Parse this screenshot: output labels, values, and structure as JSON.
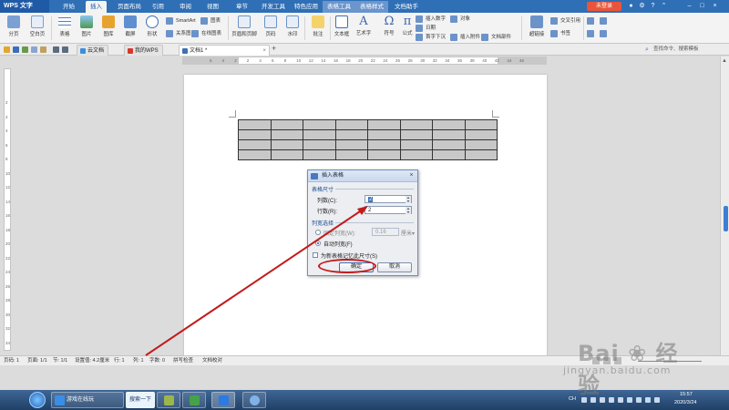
{
  "app": {
    "brand": "WPS 文字"
  },
  "menu": {
    "tabs": [
      {
        "label": "开始"
      },
      {
        "label": "插入"
      },
      {
        "label": "页面布局"
      },
      {
        "label": "引用"
      },
      {
        "label": "审阅"
      },
      {
        "label": "视图"
      },
      {
        "label": "章节"
      },
      {
        "label": "开发工具"
      },
      {
        "label": "特色应用"
      },
      {
        "label": "表格工具"
      },
      {
        "label": "表格样式"
      },
      {
        "label": "文档助手"
      }
    ],
    "login": "未登录"
  },
  "ribbon": {
    "fenye": "分页",
    "blank_page": "空白页",
    "table": "表格",
    "picture": "图片",
    "gallery": "图库",
    "screenshot": "截屏",
    "shape": "形状",
    "smartart": "SmartArt",
    "chart": "图表",
    "relation_map": "关系图",
    "online_chart": "在线图表",
    "header_footer": "页眉和页脚",
    "page_number": "页码",
    "watermark": "水印",
    "comment": "批注",
    "textbox": "文本框",
    "wordart": "艺术字",
    "symbol": "符号",
    "formula": "公式",
    "insert_number": "插入数字",
    "object": "对象",
    "date": "日期",
    "first_drop": "首字下沉",
    "attach": "插入附件",
    "doc_parts": "文档部件",
    "hyperlink": "超链接",
    "cross_ref": "交叉引用",
    "bookmark": "书签"
  },
  "tabbar": {
    "tabs": [
      {
        "label": "云文档"
      },
      {
        "label": "我的WPS"
      },
      {
        "label": "文档1 *"
      }
    ],
    "search": "查找命令、搜索模板"
  },
  "ruler": {
    "h_numbers": [
      "6",
      "4",
      "2",
      "2",
      "4",
      "6",
      "8",
      "10",
      "12",
      "14",
      "16",
      "18",
      "20",
      "22",
      "24",
      "26",
      "28",
      "30",
      "32",
      "34",
      "36",
      "38",
      "40",
      "42",
      "44",
      "46"
    ],
    "v_numbers": [
      "2",
      "2",
      "4",
      "6",
      "8",
      "10",
      "12",
      "14",
      "16",
      "18",
      "20",
      "22",
      "24",
      "26",
      "28",
      "30",
      "32",
      "34",
      "36"
    ]
  },
  "preview_table": {
    "rows": 4,
    "cols": 8
  },
  "dialog": {
    "title": "插入表格",
    "size_group": "表格尺寸",
    "cols_label": "列数(C):",
    "cols_value": "2",
    "rows_label": "行数(R):",
    "rows_value": "2",
    "width_group": "列宽选择",
    "fixed_width_label": "固定列宽(W):",
    "fixed_width_value": "0.16",
    "fixed_width_unit": "厘米",
    "auto_width_label": "自动列宽(F)",
    "remember_label": "为新表格记忆此尺寸(S)",
    "ok": "确定",
    "cancel": "取消"
  },
  "statusbar": {
    "page_no": "页码: 1",
    "pages": "页面: 1/1",
    "section": "节: 1/1",
    "setting": "设置值: 4.2厘米",
    "row": "行: 1",
    "col": "列: 1",
    "words": "字数: 0",
    "spellcheck": "拼写检查",
    "doc_check": "文档校对"
  },
  "taskbar": {
    "browser": "游戏在线玩",
    "search": "搜索一下",
    "lang": "CH",
    "time": "15:57",
    "date": "2020/3/24"
  },
  "watermark": {
    "brand": "Bai",
    "brand2": "经验",
    "url": "jingyan.baidu.com"
  },
  "colors": {
    "menubar": "#2f6fb6",
    "accent_red": "#c31a1a",
    "login": "#e9553a",
    "table_fill": "#c8c8c8"
  }
}
